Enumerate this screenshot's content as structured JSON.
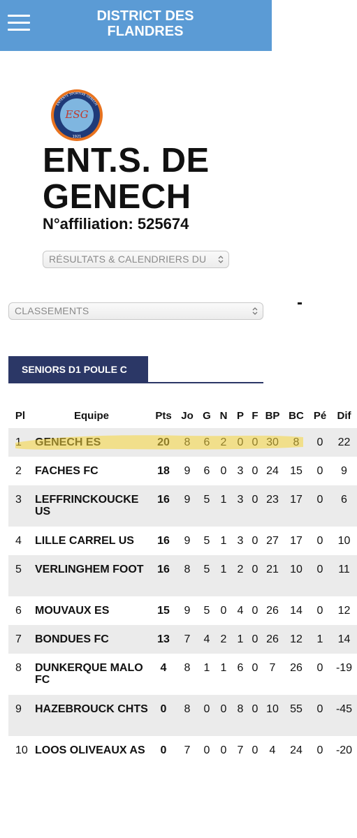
{
  "header": {
    "menu_icon": "hamburger-menu-icon",
    "title": "DISTRICT DES FLANDRES",
    "accent_color": "#5b9bd5"
  },
  "club": {
    "logo_icon": "club-crest-icon",
    "logo_text_top": "ENTENTE SPORTIVE GENECH",
    "logo_initials": "ESG",
    "logo_year": "1921",
    "name": "ENT.S. DE GENECH",
    "affiliation": "N°affiliation: 525674"
  },
  "selects": {
    "results_value": "RÉSULTATS & CALENDRIERS DU",
    "classement_value": "CLASSEMENTS"
  },
  "tab": {
    "label": "SENIORS D1 POULE C",
    "color": "#2b3766"
  },
  "table": {
    "headers": {
      "pos": "Pl",
      "team": "Equipe",
      "pts": "Pts",
      "jo": "Jo",
      "g": "G",
      "n": "N",
      "p": "P",
      "f": "F",
      "bp": "BP",
      "bc": "BC",
      "pe": "Pé",
      "dif": "Dif"
    },
    "rows": [
      {
        "pos": "1",
        "team": "GENECH ES",
        "pts": "20",
        "jo": "8",
        "g": "6",
        "n": "2",
        "p": "0",
        "f": "0",
        "bp": "30",
        "bc": "8",
        "pe": "0",
        "dif": "22"
      },
      {
        "pos": "2",
        "team": "FACHES FC",
        "pts": "18",
        "jo": "9",
        "g": "6",
        "n": "0",
        "p": "3",
        "f": "0",
        "bp": "24",
        "bc": "15",
        "pe": "0",
        "dif": "9"
      },
      {
        "pos": "3",
        "team": "LEFFRINCKOUCKE US",
        "pts": "16",
        "jo": "9",
        "g": "5",
        "n": "1",
        "p": "3",
        "f": "0",
        "bp": "23",
        "bc": "17",
        "pe": "0",
        "dif": "6"
      },
      {
        "pos": "4",
        "team": "LILLE CARREL US",
        "pts": "16",
        "jo": "9",
        "g": "5",
        "n": "1",
        "p": "3",
        "f": "0",
        "bp": "27",
        "bc": "17",
        "pe": "0",
        "dif": "10"
      },
      {
        "pos": "5",
        "team": "VERLINGHEM FOOT",
        "pts": "16",
        "jo": "8",
        "g": "5",
        "n": "1",
        "p": "2",
        "f": "0",
        "bp": "21",
        "bc": "10",
        "pe": "0",
        "dif": "11"
      },
      {
        "pos": "6",
        "team": "MOUVAUX ES",
        "pts": "15",
        "jo": "9",
        "g": "5",
        "n": "0",
        "p": "4",
        "f": "0",
        "bp": "26",
        "bc": "14",
        "pe": "0",
        "dif": "12"
      },
      {
        "pos": "7",
        "team": "BONDUES FC",
        "pts": "13",
        "jo": "7",
        "g": "4",
        "n": "2",
        "p": "1",
        "f": "0",
        "bp": "26",
        "bc": "12",
        "pe": "1",
        "dif": "14"
      },
      {
        "pos": "8",
        "team": "DUNKERQUE MALO FC",
        "pts": "4",
        "jo": "8",
        "g": "1",
        "n": "1",
        "p": "6",
        "f": "0",
        "bp": "7",
        "bc": "26",
        "pe": "0",
        "dif": "-19"
      },
      {
        "pos": "9",
        "team": "HAZEBROUCK CHTS",
        "pts": "0",
        "jo": "8",
        "g": "0",
        "n": "0",
        "p": "8",
        "f": "0",
        "bp": "10",
        "bc": "55",
        "pe": "0",
        "dif": "-45"
      },
      {
        "pos": "10",
        "team": "LOOS OLIVEAUX AS",
        "pts": "0",
        "jo": "7",
        "g": "0",
        "n": "0",
        "p": "7",
        "f": "0",
        "bp": "4",
        "bc": "24",
        "pe": "0",
        "dif": "-20"
      }
    ],
    "highlight_color": "#f5d63d"
  }
}
